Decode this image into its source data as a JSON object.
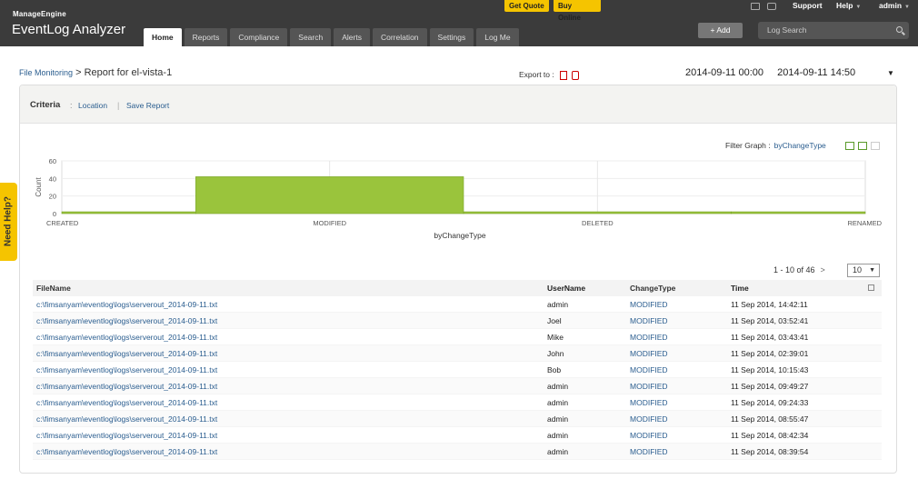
{
  "header": {
    "brand_small": "ManageEngine",
    "brand_large": "EventLog Analyzer",
    "get_quote": "Get Quote",
    "buy_online": "Buy Online",
    "support": "Support",
    "help": "Help",
    "admin": "admin",
    "add_button": "+ Add",
    "search_placeholder": "Log Search",
    "tabs": [
      "Home",
      "Reports",
      "Compliance",
      "Search",
      "Alerts",
      "Correlation",
      "Settings",
      "Log Me"
    ]
  },
  "breadcrumb": {
    "parent": "File Monitoring",
    "separator": ">",
    "current": "Report for el-vista-1"
  },
  "export": {
    "label": "Export to :"
  },
  "daterange": {
    "from": "2014-09-11 00:00",
    "to": "2014-09-11 14:50"
  },
  "criteria": {
    "label": "Criteria",
    "colon": ":",
    "location": "Location",
    "pipe": "|",
    "save_report": "Save Report"
  },
  "filter_graph": {
    "label": "Filter Graph :",
    "value": "byChangeType"
  },
  "chart_data": {
    "type": "area",
    "categories": [
      "CREATED",
      "MODIFIED",
      "DELETED",
      "RENAMED"
    ],
    "values": [
      1,
      42,
      2,
      0
    ],
    "xlabel": "byChangeType",
    "ylabel": "Count",
    "ylim": [
      0,
      60
    ],
    "yticks": [
      0,
      20,
      40,
      60
    ],
    "color": "#9ac43c"
  },
  "pager": {
    "text": "1 - 10 of 46",
    "next": ">",
    "page_size": "10"
  },
  "table": {
    "headers": [
      "FileName",
      "UserName",
      "ChangeType",
      "Time"
    ],
    "rows": [
      [
        "c:\\fimsanyam\\eventlog\\logs\\serverout_2014-09-11.txt",
        "admin",
        "MODIFIED",
        "11 Sep 2014, 14:42:11"
      ],
      [
        "c:\\fimsanyam\\eventlog\\logs\\serverout_2014-09-11.txt",
        "Joel",
        "MODIFIED",
        "11 Sep 2014, 03:52:41"
      ],
      [
        "c:\\fimsanyam\\eventlog\\logs\\serverout_2014-09-11.txt",
        "Mike",
        "MODIFIED",
        "11 Sep 2014, 03:43:41"
      ],
      [
        "c:\\fimsanyam\\eventlog\\logs\\serverout_2014-09-11.txt",
        "John",
        "MODIFIED",
        "11 Sep 2014, 02:39:01"
      ],
      [
        "c:\\fimsanyam\\eventlog\\logs\\serverout_2014-09-11.txt",
        "Bob",
        "MODIFIED",
        "11 Sep 2014, 10:15:43"
      ],
      [
        "c:\\fimsanyam\\eventlog\\logs\\serverout_2014-09-11.txt",
        "admin",
        "MODIFIED",
        "11 Sep 2014, 09:49:27"
      ],
      [
        "c:\\fimsanyam\\eventlog\\logs\\serverout_2014-09-11.txt",
        "admin",
        "MODIFIED",
        "11 Sep 2014, 09:24:33"
      ],
      [
        "c:\\fimsanyam\\eventlog\\logs\\serverout_2014-09-11.txt",
        "admin",
        "MODIFIED",
        "11 Sep 2014, 08:55:47"
      ],
      [
        "c:\\fimsanyam\\eventlog\\logs\\serverout_2014-09-11.txt",
        "admin",
        "MODIFIED",
        "11 Sep 2014, 08:42:34"
      ],
      [
        "c:\\fimsanyam\\eventlog\\logs\\serverout_2014-09-11.txt",
        "admin",
        "MODIFIED",
        "11 Sep 2014, 08:39:54"
      ]
    ]
  },
  "need_help": "Need Help?"
}
